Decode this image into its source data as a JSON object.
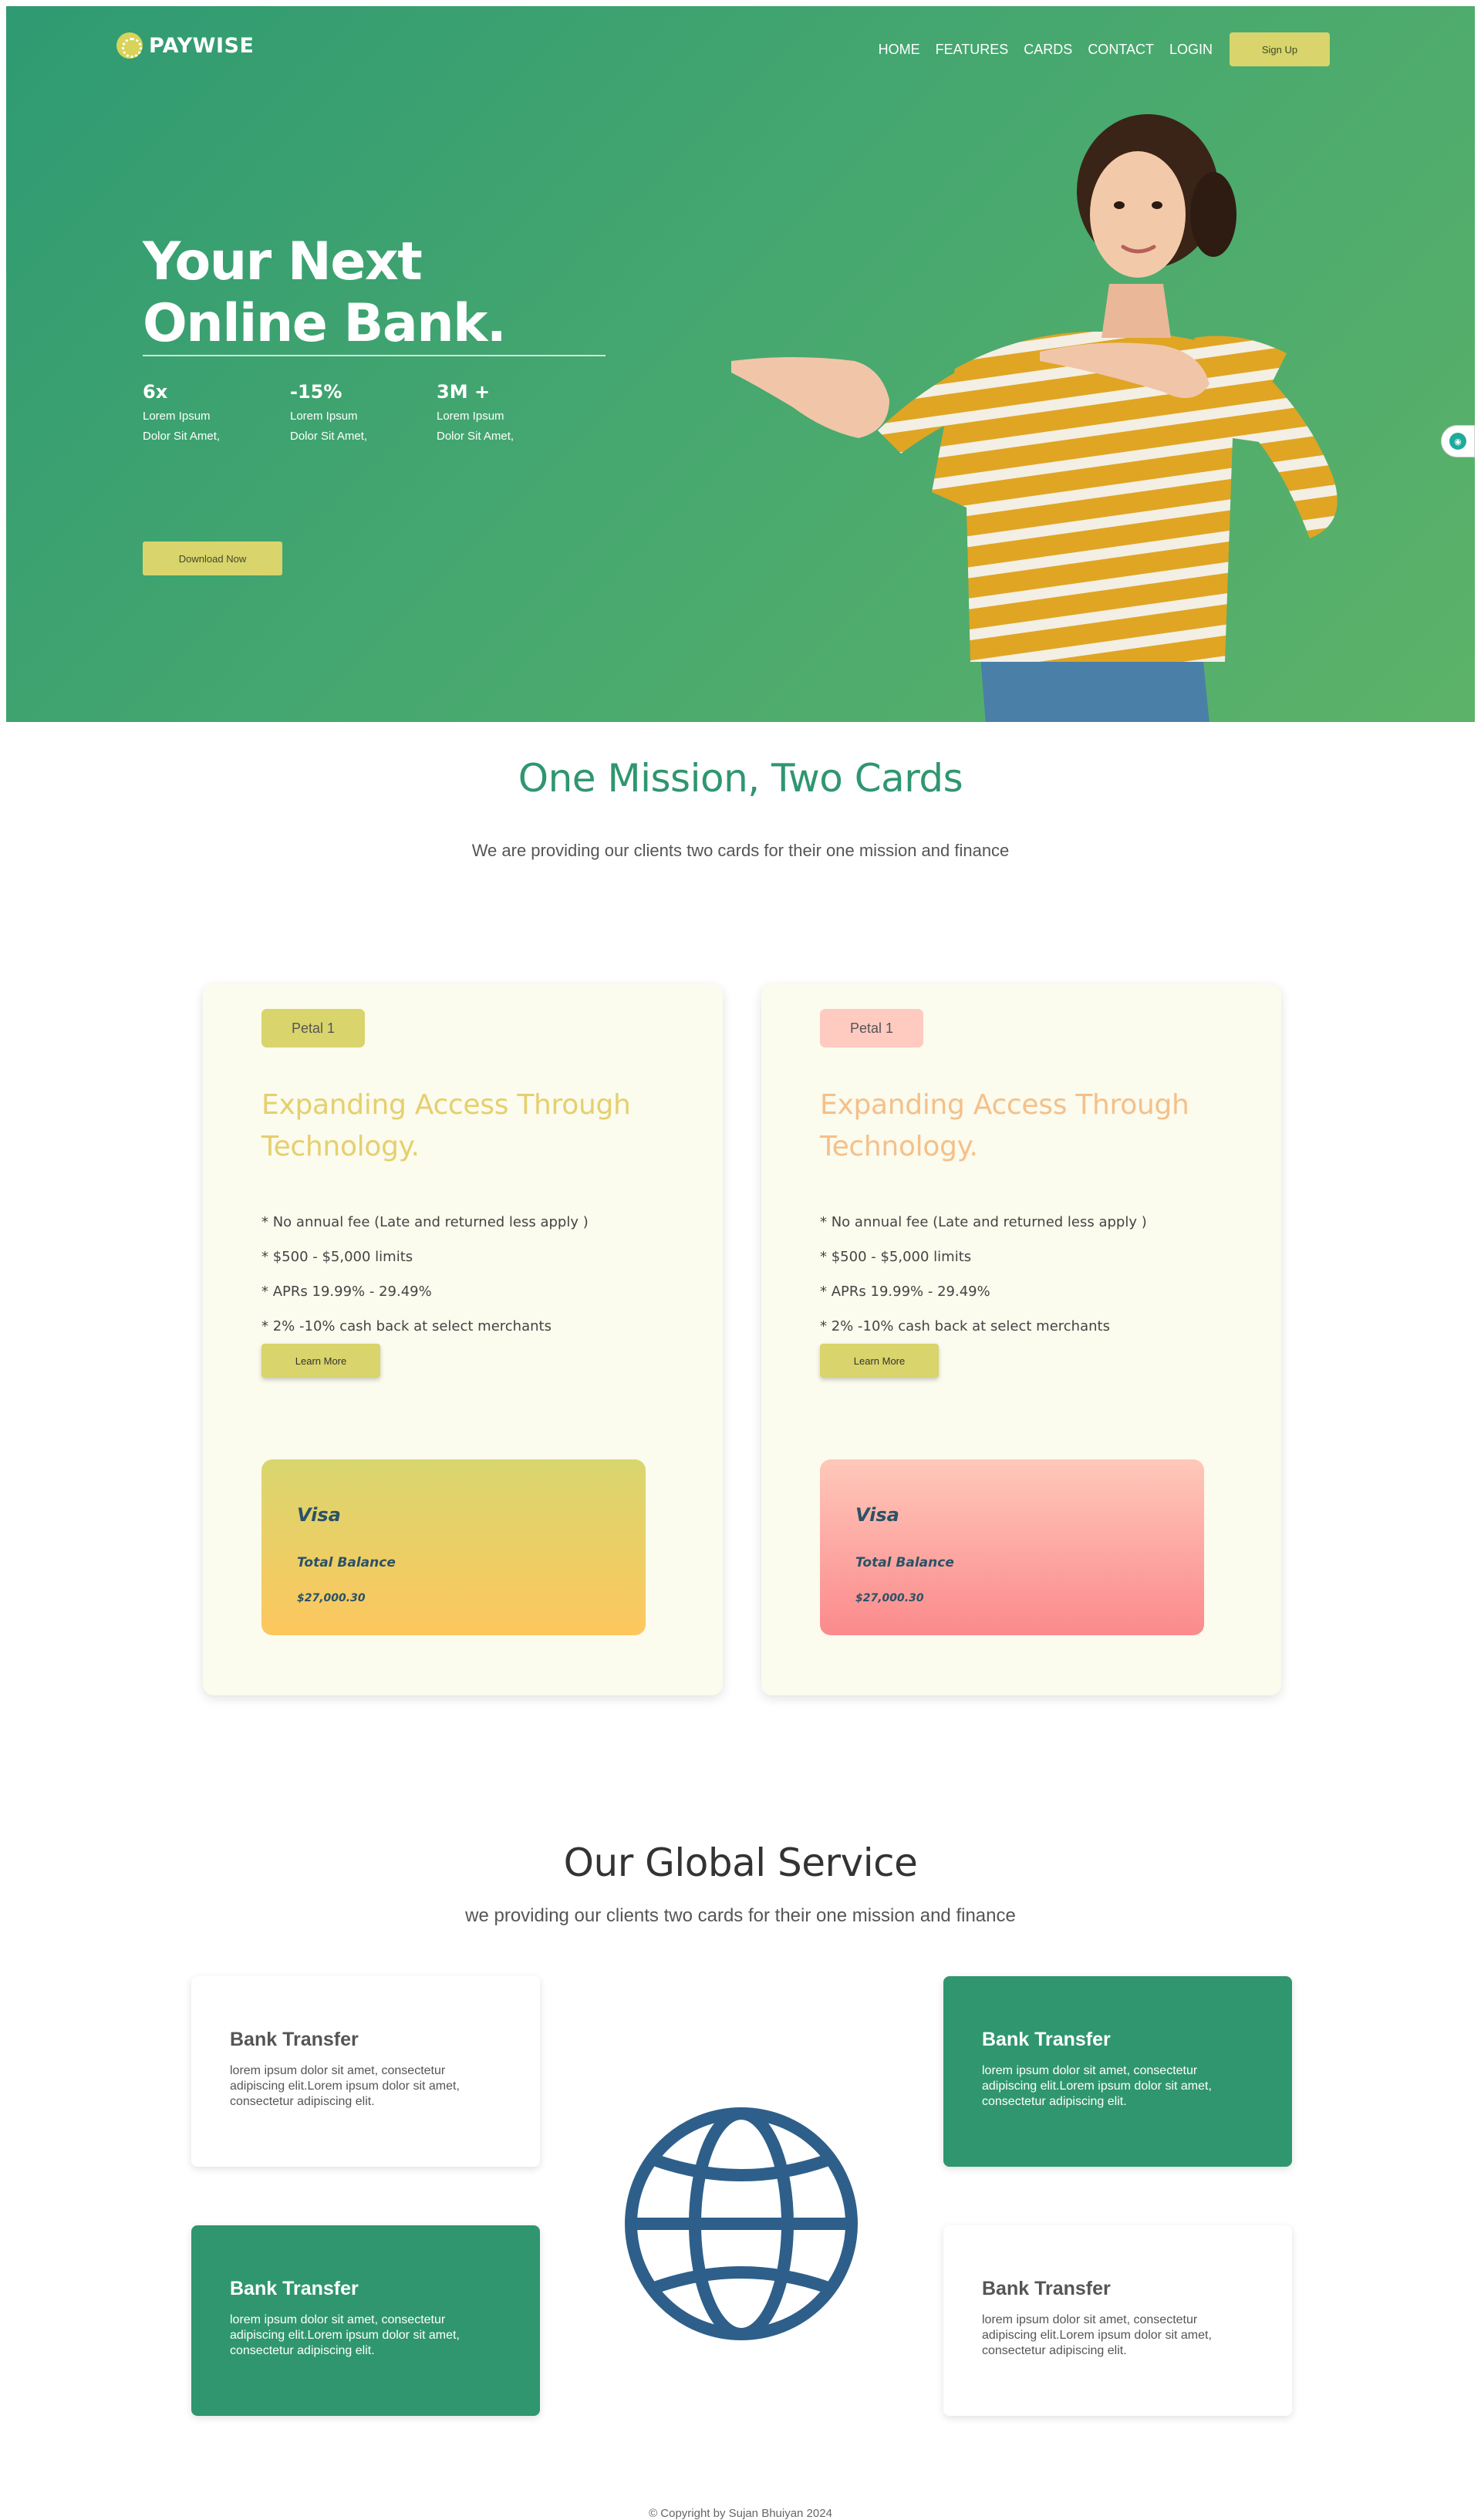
{
  "brand": {
    "name": "PAYWISE"
  },
  "nav": {
    "items": [
      "HOME",
      "FEATURES",
      "CARDS",
      "CONTACT",
      "LOGIN"
    ],
    "signup_label": "Sign Up"
  },
  "hero": {
    "title_line1": "Your Next",
    "title_line2": "Online Bank.",
    "stats": [
      {
        "value": "6x",
        "line1": "Lorem Ipsum",
        "line2": "Dolor Sit Amet,"
      },
      {
        "value": "-15%",
        "line1": "Lorem Ipsum",
        "line2": "Dolor Sit Amet,"
      },
      {
        "value": "3M +",
        "line1": "Lorem Ipsum",
        "line2": "Dolor Sit Amet,"
      }
    ],
    "download_label": "Download Now"
  },
  "mission": {
    "title": "One Mission, Two Cards",
    "subtitle": "We are providing our clients two cards for their one mission and finance",
    "cards": [
      {
        "tag": "Petal 1",
        "heading": "Expanding Access Through Technology.",
        "features": [
          "* No annual fee (Late and returned less apply )",
          "* $500 - $5,000 limits",
          "* APRs 19.99% - 29.49%",
          "* 2% -10% cash back at select merchants"
        ],
        "button": "Learn More",
        "visa": {
          "brand": "Visa",
          "label": "Total Balance",
          "amount": "$27,000.30"
        },
        "tag_color": "#d9d46b",
        "heading_color": "#e6cf6e",
        "visa_gradient": [
          "#d9d66e",
          "#fdc75e"
        ]
      },
      {
        "tag": "Petal 1",
        "heading": "Expanding Access Through Technology.",
        "features": [
          "* No annual fee (Late and returned less apply )",
          "* $500 - $5,000 limits",
          "* APRs 19.99% - 29.49%",
          "* 2% -10% cash back at select merchants"
        ],
        "button": "Learn More",
        "visa": {
          "brand": "Visa",
          "label": "Total Balance",
          "amount": "$27,000.30"
        },
        "tag_color": "#ffcac0",
        "heading_color": "#f5c089",
        "visa_gradient": [
          "#ffc8ba",
          "#fb8a8c"
        ]
      }
    ]
  },
  "global": {
    "title": "Our Global Service",
    "subtitle": "we providing our clients two cards for their one mission and finance",
    "services": [
      {
        "title": "Bank Transfer",
        "text": "lorem ipsum dolor sit amet, consectetur adipiscing elit.Lorem ipsum dolor sit amet, consectetur adipiscing elit.",
        "style": "white"
      },
      {
        "title": "Bank Transfer",
        "text": "lorem ipsum dolor sit amet, consectetur adipiscing elit.Lorem ipsum dolor sit amet, consectetur adipiscing elit.",
        "style": "green"
      },
      {
        "title": "Bank Transfer",
        "text": "lorem ipsum dolor sit amet, consectetur adipiscing elit.Lorem ipsum dolor sit amet, consectetur adipiscing elit.",
        "style": "green"
      },
      {
        "title": "Bank Transfer",
        "text": "lorem ipsum dolor sit amet, consectetur adipiscing elit.Lorem ipsum dolor sit amet, consectetur adipiscing elit.",
        "style": "white"
      }
    ],
    "icon": "globe-icon"
  },
  "footer": {
    "text": "© Copyright by Sujan Bhuiyan 2024"
  },
  "colors": {
    "primary": "#2f9670",
    "accent": "#d9d46b",
    "globe": "#2e5f8a"
  }
}
